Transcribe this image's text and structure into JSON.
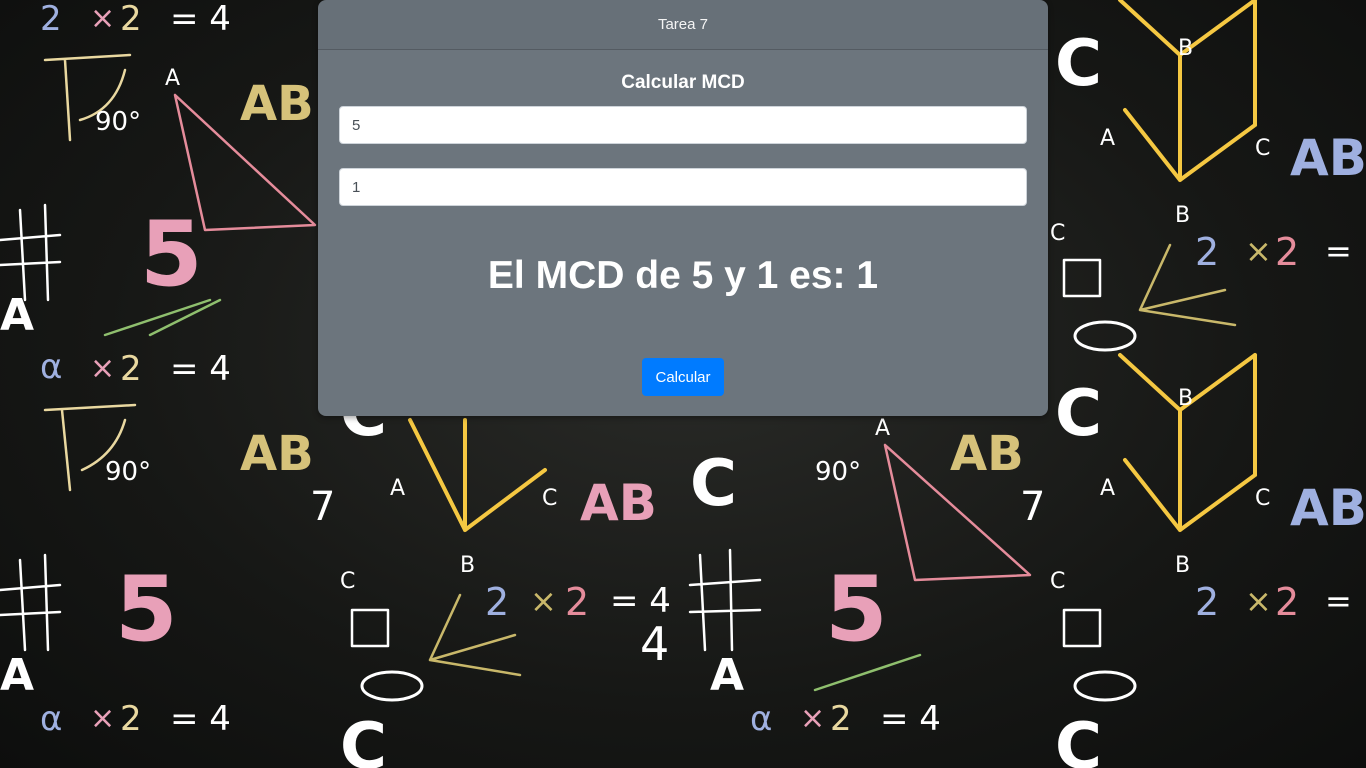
{
  "header": {
    "title": "Tarea 7"
  },
  "form": {
    "title": "Calcular MCD",
    "input1_value": "5",
    "input2_value": "1",
    "result": "El MCD de 5 y 1 es: 1",
    "button_label": "Calcular"
  },
  "colors": {
    "card": "#6c757d",
    "button": "#007bff"
  }
}
